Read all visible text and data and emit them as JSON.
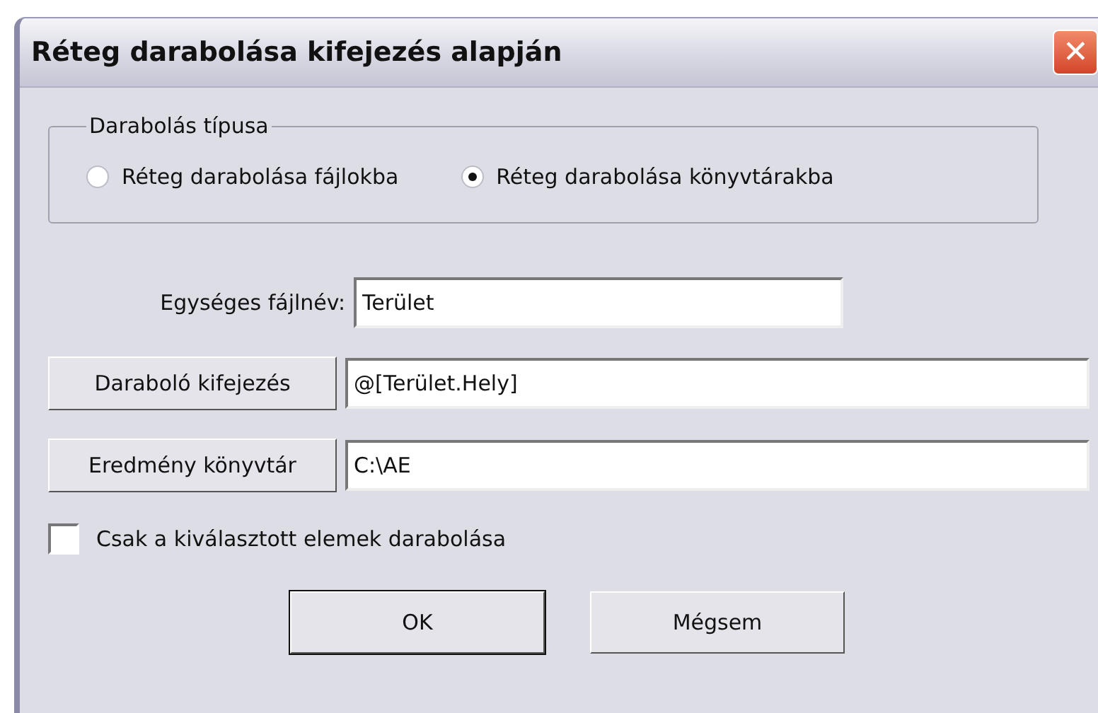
{
  "window": {
    "title": "Réteg darabolása kifejezés alapján",
    "close": "✕"
  },
  "split_type": {
    "legend": "Darabolás típusa",
    "options": [
      {
        "label": "Réteg darabolása fájlokba",
        "selected": false
      },
      {
        "label": "Réteg darabolása könyvtárakba",
        "selected": true
      }
    ]
  },
  "fields": [
    {
      "kind": "label",
      "label": "Egységes fájlnév:",
      "value": "Terület"
    },
    {
      "kind": "button",
      "label": "Daraboló kifejezés",
      "value": "@[Terület.Hely]"
    },
    {
      "kind": "button",
      "label": "Eredmény könyvtár",
      "value": "C:\\AE"
    }
  ],
  "only_selected": {
    "label": "Csak a kiválasztott elemek darabolása",
    "checked": false
  },
  "buttons": [
    {
      "label": "OK",
      "default": true
    },
    {
      "label": "Mégsem",
      "default": false
    }
  ]
}
